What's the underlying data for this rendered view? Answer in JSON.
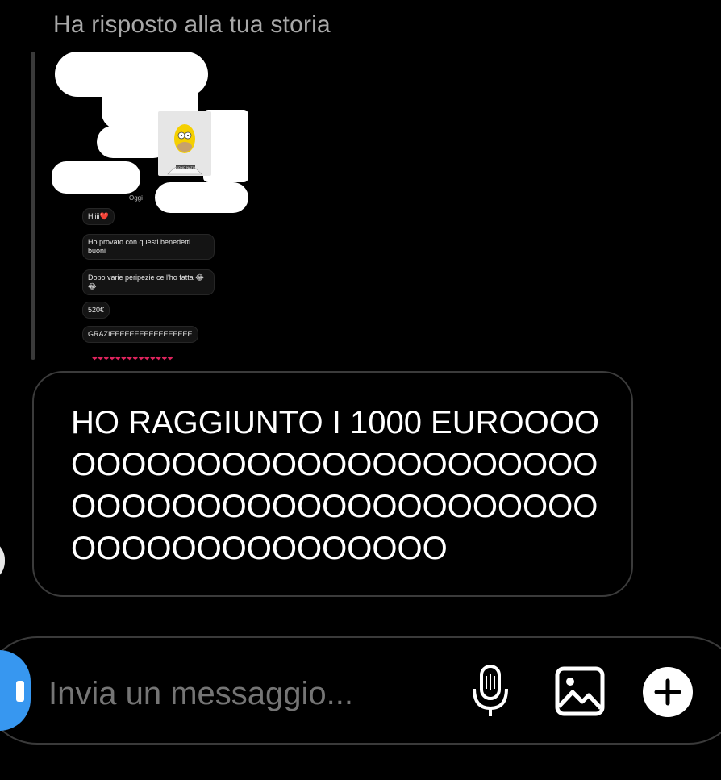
{
  "reply": {
    "header": "Ha risposto alla tua storia"
  },
  "story": {
    "sticker_text": "SONO NATO",
    "oggi": "Oggi",
    "messages": [
      "Hiiii❤️",
      "Ho provato con questi benedetti buoni",
      "Dopo varie peripezie ce l'ho fatta 😂😂",
      "520€",
      "GRAZIEEEEEEEEEEEEEEEEE"
    ],
    "hearts": "❤❤❤❤❤❤❤❤❤❤❤❤❤❤"
  },
  "message": {
    "text": "HO RAGGIUNTO I 1000 EUROOOOOOOOOOOOOOOOOOOOOOOOOOOOOOOOOOOOOOOOOOOOOOOOOOOOOOOOOOOOO"
  },
  "composer": {
    "placeholder": "Invia un messaggio..."
  },
  "icons": {
    "camera": "camera-icon",
    "mic": "microphone-icon",
    "gallery": "gallery-icon",
    "plus": "plus-icon"
  },
  "colors": {
    "background": "#000000",
    "accent": "#3797f0",
    "header_text": "#a8a8a8",
    "bubble_border": "#3b3b3b"
  }
}
